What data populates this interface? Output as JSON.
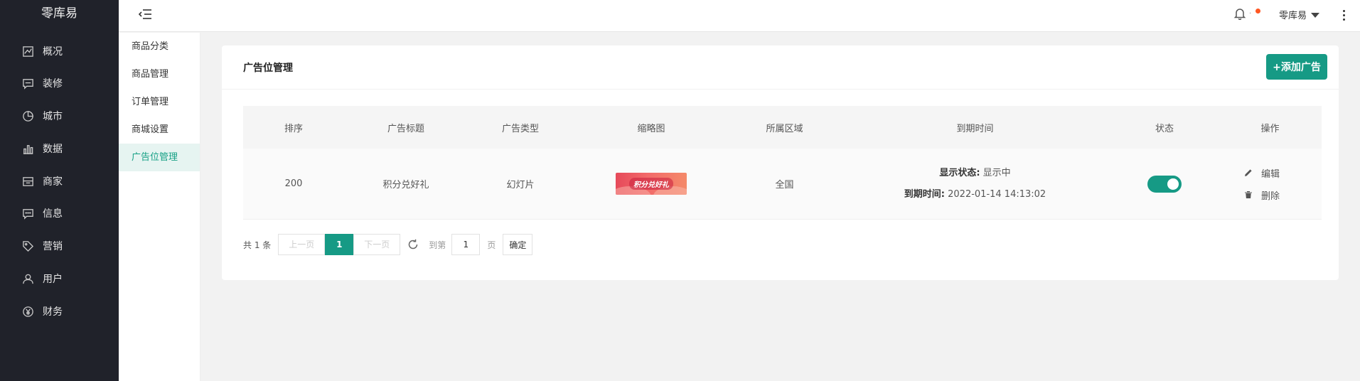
{
  "app": {
    "brand": "零库易"
  },
  "sidebar": {
    "items": [
      {
        "label": "概况",
        "icon": "dashboard-icon"
      },
      {
        "label": "装修",
        "icon": "message-icon"
      },
      {
        "label": "城市",
        "icon": "compass-icon"
      },
      {
        "label": "数据",
        "icon": "bar-chart-icon"
      },
      {
        "label": "商家",
        "icon": "store-icon"
      },
      {
        "label": "信息",
        "icon": "chat-icon"
      },
      {
        "label": "营销",
        "icon": "tag-icon"
      },
      {
        "label": "用户",
        "icon": "user-icon"
      },
      {
        "label": "财务",
        "icon": "yen-icon"
      }
    ]
  },
  "header": {
    "user_name": "零库易",
    "has_notification": true,
    "notification_dot_color": "#ff5722"
  },
  "submenu": {
    "items": [
      {
        "label": "商品分类"
      },
      {
        "label": "商品管理"
      },
      {
        "label": "订单管理"
      },
      {
        "label": "商城设置"
      },
      {
        "label": "广告位管理",
        "active": true
      }
    ]
  },
  "page": {
    "title": "广告位管理",
    "add_button": "+添加广告"
  },
  "table": {
    "columns": [
      "排序",
      "广告标题",
      "广告类型",
      "缩略图",
      "所属区域",
      "到期时间",
      "状态",
      "操作"
    ],
    "rows": [
      {
        "sort": "200",
        "title": "积分兑好礼",
        "type": "幻灯片",
        "thumbnail_text": "积分兑好礼",
        "region": "全国",
        "display_label": "显示状态:",
        "display_value": "显示中",
        "expire_label": "到期时间:",
        "expire_value": "2022-01-14 14:13:02",
        "enabled": true,
        "edit_label": "编辑",
        "delete_label": "删除"
      }
    ]
  },
  "pagination": {
    "total_text": "共 1 条",
    "prev": "上一页",
    "current": "1",
    "next": "下一页",
    "goto_label": "到第",
    "goto_value": "1",
    "page_unit": "页",
    "confirm": "确定"
  },
  "colors": {
    "accent": "#169a85",
    "sidebar_bg": "#20222a"
  }
}
